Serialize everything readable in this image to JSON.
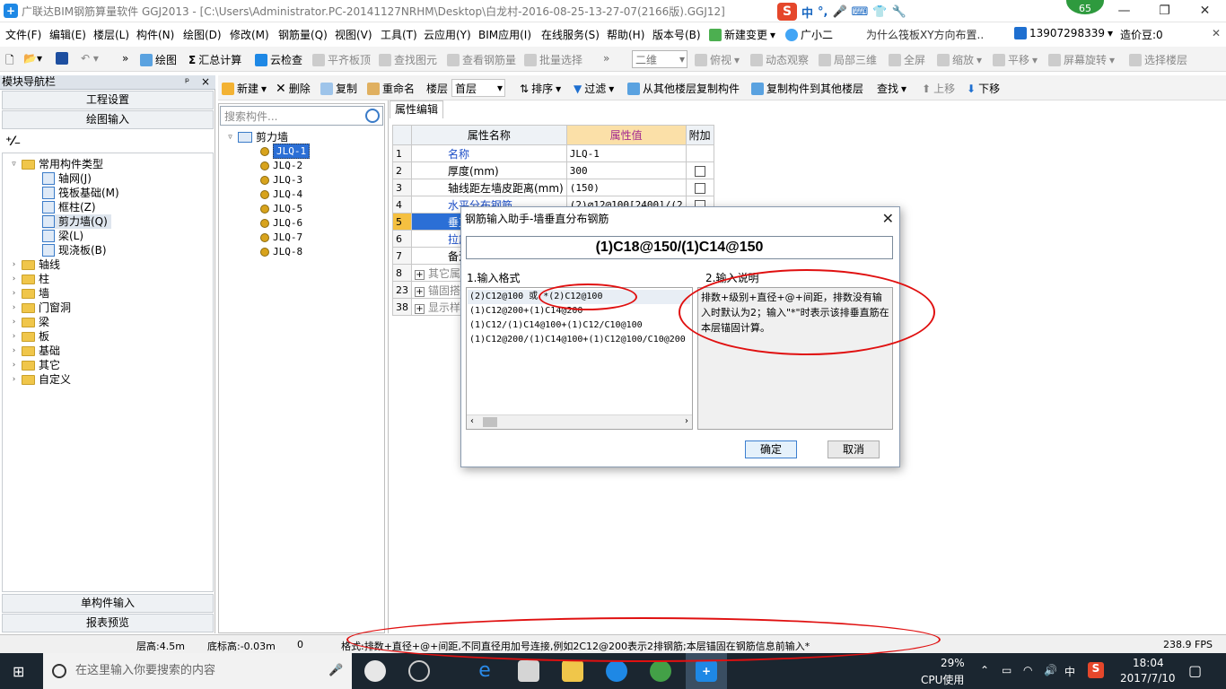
{
  "window": {
    "title": "广联达BIM钢筋算量软件 GGJ2013 - [C:\\Users\\Administrator.PC-20141127NRHM\\Desktop\\白龙村-2016-08-25-13-27-07(2166版).GGJ12]",
    "badge": "65",
    "ime_items": [
      "中",
      "°,",
      "🎤",
      "⌨",
      "👕",
      "🔧"
    ]
  },
  "menu": [
    "文件(F)",
    "编辑(E)",
    "楼层(L)",
    "构件(N)",
    "绘图(D)",
    "修改(M)",
    "钢筋量(Q)",
    "视图(V)",
    "工具(T)",
    "云应用(Y)",
    "BIM应用(I)",
    "在线服务(S)",
    "帮助(H)",
    "版本号(B)",
    "新建变更",
    "广小二",
    "为什么筏板XY方向布置..",
    "13907298339",
    "造价豆:0"
  ],
  "toolbar1": {
    "draw": "绘图",
    "sum": "汇总计算",
    "cloud_check": "云检查",
    "flat_top": "平齐板顶",
    "find_elem": "查找图元",
    "view_rebar": "查看钢筋量",
    "batch_select": "批量选择",
    "view_mode": "二维",
    "top_view": "俯视",
    "dynamic": "动态观察",
    "local3d": "局部三维",
    "full": "全屏",
    "zoom": "缩放",
    "pan": "平移",
    "rotate": "屏幕旋转",
    "select_floor": "选择楼层"
  },
  "toolbar2": {
    "new": "新建",
    "delete": "删除",
    "copy": "复制",
    "rename": "重命名",
    "floor_label": "楼层",
    "floor_value": "首层",
    "sort": "排序",
    "filter": "过滤",
    "copy_from": "从其他楼层复制构件",
    "copy_to": "复制构件到其他楼层",
    "find": "查找",
    "up": "上移",
    "down": "下移"
  },
  "nav": {
    "header": "模块导航栏",
    "pin": "ᵖ",
    "close": "×",
    "btn_project": "工程设置",
    "btn_draw": "绘图输入",
    "btn_single": "单构件输入",
    "btn_report": "报表预览",
    "tree_root": "常用构件类型",
    "tree_children": [
      "轴网(J)",
      "筏板基础(M)",
      "框柱(Z)",
      "剪力墙(Q)",
      "梁(L)",
      "现浇板(B)"
    ],
    "tree_groups": [
      "轴线",
      "柱",
      "墙",
      "门窗洞",
      "梁",
      "板",
      "基础",
      "其它",
      "自定义"
    ]
  },
  "components": {
    "search_placeholder": "搜索构件...",
    "root": "剪力墙",
    "items": [
      "JLQ-1",
      "JLQ-2",
      "JLQ-3",
      "JLQ-4",
      "JLQ-5",
      "JLQ-6",
      "JLQ-7",
      "JLQ-8"
    ]
  },
  "props": {
    "tab": "属性编辑",
    "headers": [
      "属性名称",
      "属性值",
      "附加"
    ],
    "rows": [
      {
        "num": "1",
        "name": "名称",
        "value": "JLQ-1",
        "blue": true,
        "check": false
      },
      {
        "num": "2",
        "name": "厚度(mm)",
        "value": "300",
        "blue": false,
        "check": true
      },
      {
        "num": "3",
        "name": "轴线距左墙皮距离(mm)",
        "value": "(150)",
        "blue": false,
        "check": true
      },
      {
        "num": "4",
        "name": "水平分布钢筋",
        "value": "(2)⌀12@100[2400]/(2",
        "blue": true,
        "check": true
      },
      {
        "num": "5",
        "name": "垂直分",
        "value": "",
        "blue": false,
        "check": false
      },
      {
        "num": "6",
        "name": "拉筋",
        "value": "",
        "blue": true,
        "check": false
      },
      {
        "num": "7",
        "name": "备注",
        "value": "",
        "blue": false,
        "check": false
      },
      {
        "num": "8",
        "name": "其它属",
        "value": "",
        "blue": false,
        "check": false
      },
      {
        "num": "23",
        "name": "锚固搭",
        "value": "",
        "blue": false,
        "check": false
      },
      {
        "num": "38",
        "name": "显示样",
        "value": "",
        "blue": false,
        "check": false
      }
    ]
  },
  "dialog": {
    "title": "钢筋输入助手-墙垂直分布钢筋",
    "input_value": "(1)C18@150/(1)C14@150",
    "format_label": "1.输入格式",
    "desc_label": "2.输入说明",
    "formats": [
      "(2)C12@100 或 *(2)C12@100",
      "(1)C12@200+(1)C14@200",
      "(1)C12/(1)C14@100+(1)C12/C10@100",
      "(1)C12@200/(1)C14@100+(1)C12@100/C10@200"
    ],
    "description": "排数+级别+直径+@+间距，排数没有输入时默认为2；输入\"*\"时表示该排垂直筋在本层锚固计算。",
    "ok": "确定",
    "cancel": "取消"
  },
  "status": {
    "floor_height": "层高:4.5m",
    "bottom_elev": "底标高:-0.03m",
    "zero": "0",
    "hint": "格式:排数+直径+@+间距,不同直径用加号连接,例如2C12@200表示2排钢筋;本层锚固在钢筋信息前输入*",
    "fps": "238.9 FPS"
  },
  "taskbar": {
    "search_placeholder": "在这里输入你要搜索的内容",
    "cpu_percent": "29%",
    "cpu_label": "CPU使用",
    "ime": "中",
    "time": "18:04",
    "date": "2017/7/10"
  }
}
